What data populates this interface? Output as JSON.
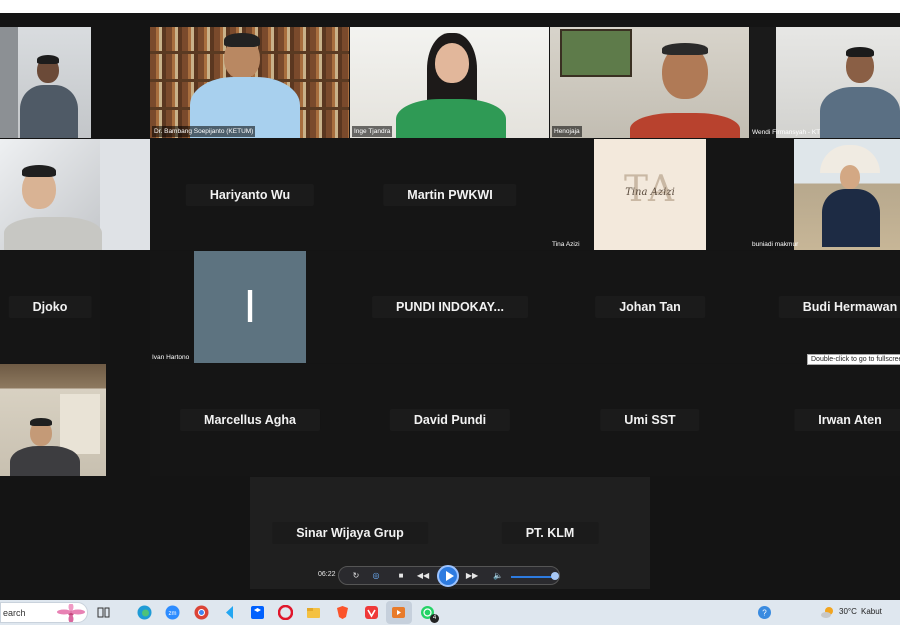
{
  "participants": {
    "p_top0": "",
    "p_bambang": "Dr. Bambang Soepijanto  (KETUM)",
    "p_inge": "Inge Tjandra",
    "p_hen": "Henojaja",
    "p_wendi": "Wendi Firmansyah - KT",
    "p_djoko_cam": "",
    "hariyanto": "Hariyanto Wu",
    "martin": "Martin PWKWI",
    "tina_label": "Tina Azizi",
    "tina_logo_text": "Tina Azizi",
    "tina_initials": "TA",
    "buniadi": "buniadi makmur",
    "djoko": "Djoko",
    "ivan_initial": "I",
    "ivan_label": "Ivan Hartono",
    "pundi_indokay": "PUNDI  INDOKAY...",
    "johan": "Johan Tan",
    "budi": "Budi Hermawan",
    "marcellus": "Marcellus Agha",
    "david": "David Pundi",
    "umi": "Umi SST",
    "irwan": "Irwan Aten",
    "sinar": "Sinar Wijaya Grup",
    "klm": "PT. KLM"
  },
  "tooltip": "Double-click to go to fullscreen",
  "player": {
    "time": "06:22"
  },
  "taskbar": {
    "search_text": "earch",
    "weather_temp": "30°C",
    "weather_desc": "Kabut",
    "whatsapp_badge": "4"
  },
  "icons": {
    "brand_accent": "#2d7be0"
  }
}
